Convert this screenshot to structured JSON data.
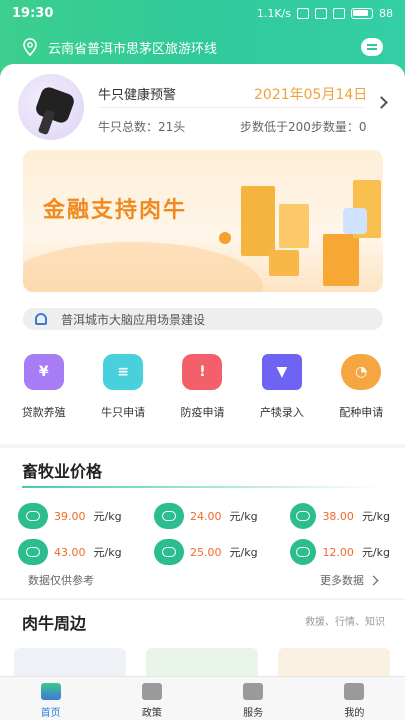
{
  "status_bar": {
    "time": "19:30",
    "net_speed": "1.1K/s",
    "battery": "88"
  },
  "location": {
    "text": "云南省普洱市思茅区旅游环线"
  },
  "health_alert": {
    "title": "牛只健康预警",
    "date": "2021年05月14日",
    "total": "牛只总数：21头",
    "steps": "步数低于200步数量：0"
  },
  "banner": {
    "text": "金融支持肉牛"
  },
  "notice": {
    "text": "普洱城市大脑应用场景建设"
  },
  "features": [
    {
      "label": "贷款养殖",
      "icon": "loan-icon",
      "color": "#9b6cf0"
    },
    {
      "label": "牛只申请",
      "icon": "cattle-apply-icon",
      "color": "#3ec8d6"
    },
    {
      "label": "防疫申请",
      "icon": "epidemic-icon",
      "color": "#f2565a"
    },
    {
      "label": "产犊录入",
      "icon": "calving-icon",
      "color": "#6b5cf0"
    },
    {
      "label": "配种申请",
      "icon": "breeding-icon",
      "color": "#f5a23a"
    }
  ],
  "prices": {
    "title": "畜牧业价格",
    "items": [
      {
        "value": "39.00",
        "unit": "元/kg",
        "icon": "cattle-icon"
      },
      {
        "value": "24.00",
        "unit": "元/kg",
        "icon": "pig-icon"
      },
      {
        "value": "38.00",
        "unit": "元/kg",
        "icon": "chicken-icon"
      },
      {
        "value": "43.00",
        "unit": "元/kg",
        "icon": "sheep-icon"
      },
      {
        "value": "25.00",
        "unit": "元/kg",
        "icon": "duck-icon"
      },
      {
        "value": "12.00",
        "unit": "元/kg",
        "icon": "fish-icon"
      }
    ],
    "note": "数据仅供参考",
    "more": "更多数据"
  },
  "beef": {
    "title": "肉牛周边",
    "tags": "救援、行情、知识"
  },
  "tabs": [
    {
      "label": "首页",
      "icon": "home-icon",
      "active": true
    },
    {
      "label": "政策",
      "icon": "policy-icon",
      "active": false
    },
    {
      "label": "服务",
      "icon": "service-icon",
      "active": false
    },
    {
      "label": "我的",
      "icon": "profile-icon",
      "active": false
    }
  ],
  "colors": {
    "primary": "#2fc99a",
    "accent": "#f0a23a",
    "price": "#f06a2a",
    "active_tab": "#2f7de0"
  }
}
